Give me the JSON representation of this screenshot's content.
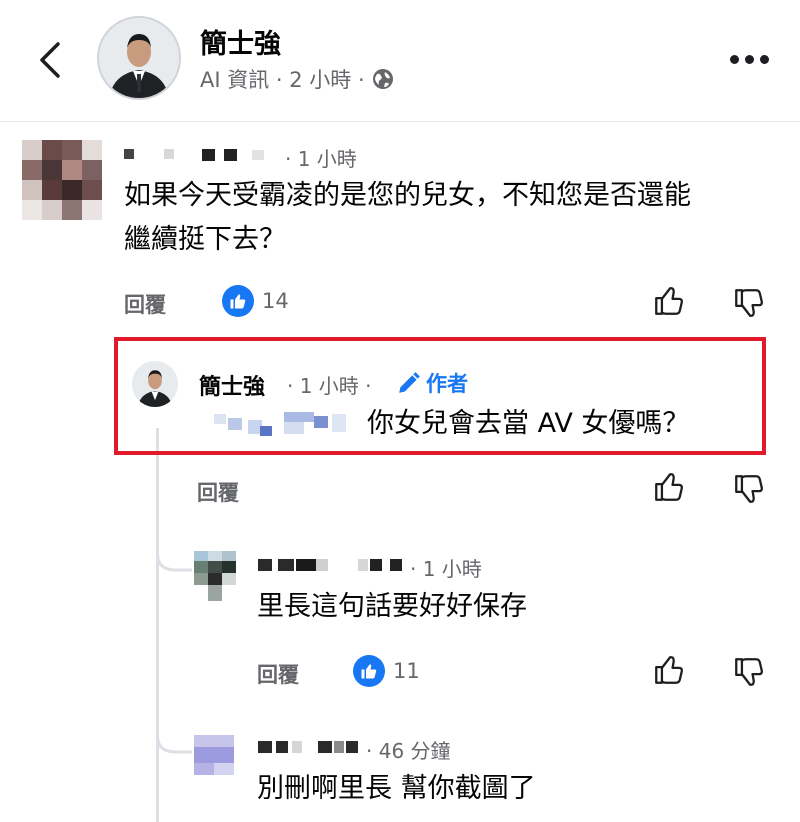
{
  "header": {
    "name": "簡士強",
    "subtitle": "AI 資訊 · 2 小時 ·"
  },
  "comments": [
    {
      "time": "· 1 小時",
      "text_line1": "如果今天受霸凌的是您的兒女，不知您是否還能",
      "text_line2": "繼續挺下去？",
      "reply_label": "回覆",
      "likes": "14"
    },
    {
      "name": "簡士強",
      "time": "· 1 小時 ·",
      "badge": "作者",
      "text": "你女兒會去當 AV 女優嗎？",
      "reply_label": "回覆"
    },
    {
      "time": "· 1 小時",
      "text": "里長這句話要好好保存",
      "reply_label": "回覆",
      "likes": "11"
    },
    {
      "time": "· 46 分鐘",
      "text": "別刪啊里長 幫你截圖了"
    }
  ],
  "icons": {
    "back": "chevron-left-icon",
    "more": "more-horizontal-icon",
    "globe": "globe-icon",
    "like": "like-icon",
    "thumb_up": "thumbs-up-icon",
    "thumb_down": "thumbs-down-icon",
    "pencil": "pencil-icon"
  },
  "colors": {
    "accent": "#1877f2",
    "highlight_border": "#e0192b",
    "muted_text": "#65676b"
  }
}
